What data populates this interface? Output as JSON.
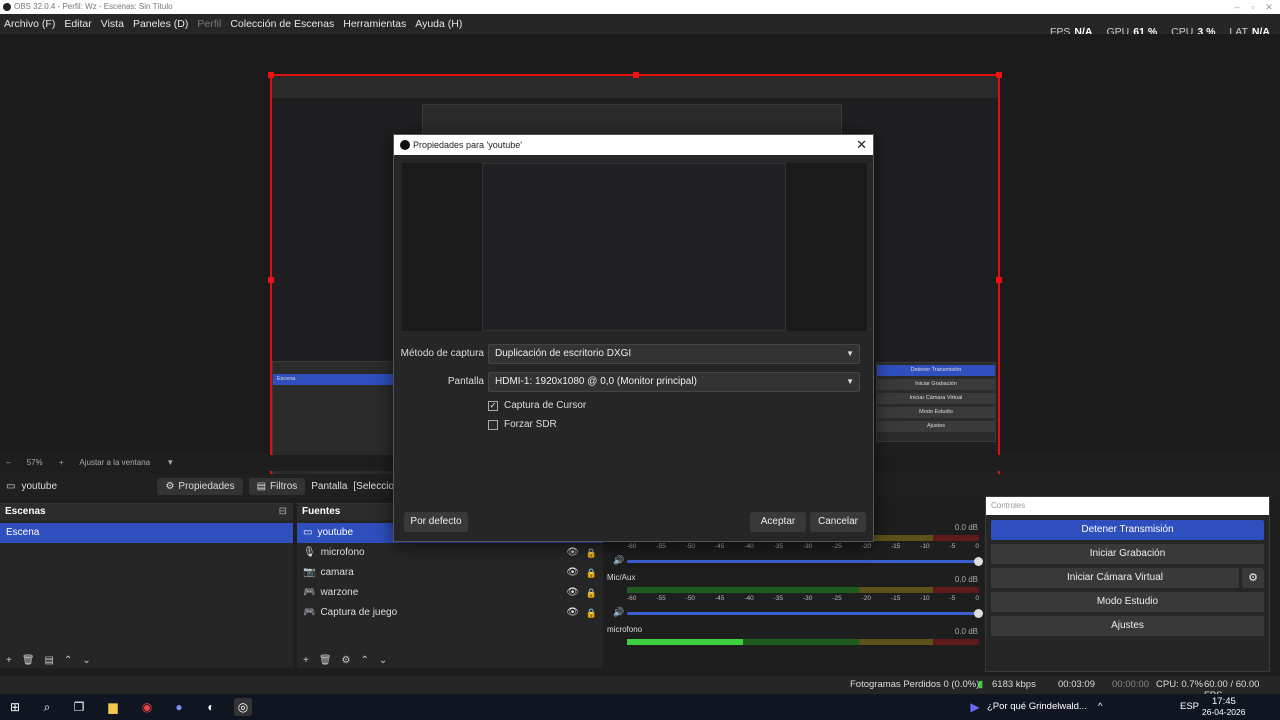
{
  "window": {
    "title": "OBS 32.0.4 - Perfil: Wz - Escenas: Sin Título"
  },
  "menu": {
    "items": [
      "Archivo (F)",
      "Editar",
      "Vista",
      "Paneles (D)",
      "Perfil",
      "Colección de Escenas",
      "Herramientas",
      "Ayuda (H)"
    ]
  },
  "stats": {
    "fps_label": "FPS",
    "fps_value": "N/A",
    "gpu_label": "GPU",
    "gpu_value": "61 %",
    "cpu_label": "CPU",
    "cpu_value": "3 %",
    "lat_label": "LAT",
    "lat_value": "N/A"
  },
  "zoom": {
    "value": "57%",
    "mode": "Ajustar a la ventana"
  },
  "source_toolbar": {
    "source_name": "youtube",
    "properties_label": "Propiedades",
    "filters_label": "Filtros",
    "display_label": "Pantalla",
    "select_label": "[Seleccionar pa"
  },
  "scenes": {
    "title": "Escenas",
    "items": [
      "Escena"
    ]
  },
  "sources": {
    "title": "Fuentes",
    "items": [
      "youtube",
      "microfono",
      "camara",
      "warzone",
      "Captura de juego"
    ]
  },
  "mixer": {
    "channels": [
      {
        "name": "",
        "db": "0.0 dB",
        "level": 0.48
      },
      {
        "name": "Mic/Aux",
        "db": "0.0 dB",
        "level": 0.0
      },
      {
        "name": "microfono",
        "db": "0.0 dB",
        "level": 0.33
      }
    ],
    "ticks": [
      "-60",
      "-55",
      "-50",
      "-45",
      "-40",
      "-35",
      "-30",
      "-25",
      "-20",
      "-15",
      "-10",
      "-5",
      "0"
    ]
  },
  "controls": {
    "title": "Controles",
    "stop_stream": "Detener Transmisión",
    "start_recording": "Iniciar Grabación",
    "start_virtual_cam": "Iniciar Cámara Virtual",
    "studio_mode": "Modo Estudio",
    "settings": "Ajustes"
  },
  "statusbar": {
    "dropped_frames": "Fotogramas Perdidos 0 (0.0%)",
    "bitrate": "6183 kbps",
    "stream_time": "00:03:09",
    "rec_time": "00:00:00",
    "cpu": "CPU: 0.7%",
    "fps": "60.00 / 60.00 FPS"
  },
  "dialog": {
    "title": "Propiedades para 'youtube'",
    "capture_method_label": "Método de captura",
    "capture_method_value": "Duplicación de escritorio DXGI",
    "display_label": "Pantalla",
    "display_value": "HDMI-1: 1920x1080 @ 0,0 (Monitor principal)",
    "capture_cursor_label": "Captura de Cursor",
    "capture_cursor_checked": true,
    "force_sdr_label": "Forzar SDR",
    "force_sdr_checked": false,
    "defaults_button": "Por defecto",
    "accept_button": "Aceptar",
    "cancel_button": "Cancelar"
  },
  "taskbar": {
    "notification": "¿Por qué Grindelwald...",
    "language": "ESP",
    "time": "17:45",
    "date": "26-04-2026"
  },
  "colors": {
    "accent": "#2f4fbf",
    "selection_border": "#dd1111",
    "meter_green": "#3fd03f"
  }
}
